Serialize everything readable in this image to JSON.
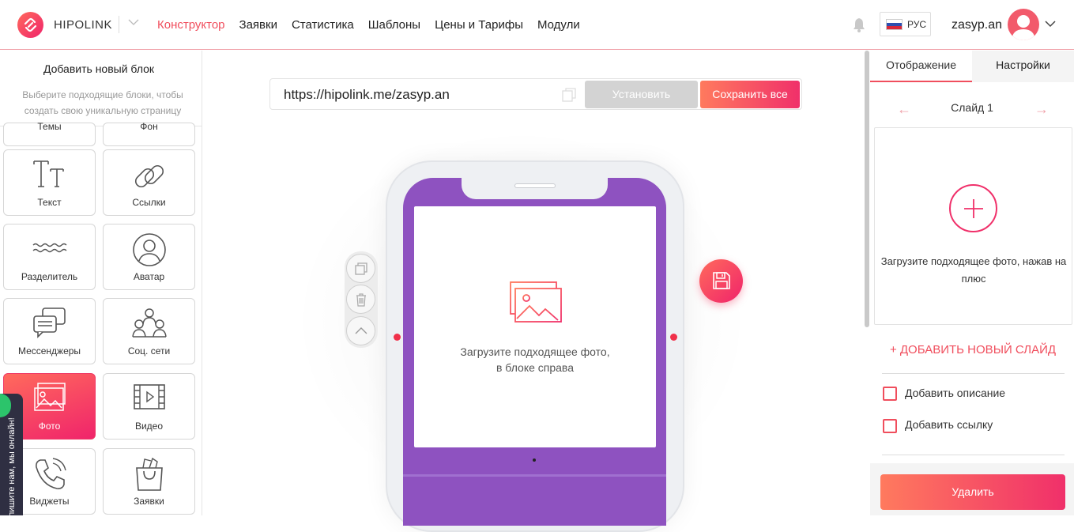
{
  "header": {
    "brand": "HIPOLINK",
    "nav": [
      {
        "label": "Конструктор",
        "active": true
      },
      {
        "label": "Заявки"
      },
      {
        "label": "Статистика"
      },
      {
        "label": "Шаблоны"
      },
      {
        "label": "Цены и Тарифы"
      },
      {
        "label": "Модули"
      }
    ],
    "lang": "РУС",
    "username": "zasyp.an",
    "accent_color": "#f04e5d"
  },
  "left_panel": {
    "title": "Добавить новый блок",
    "subtitle": "Выберите подходящие блоки, чтобы создать свою уникальную страницу",
    "tiles": [
      {
        "label": "Темы"
      },
      {
        "label": "Фон"
      },
      {
        "label": "Текст",
        "icon": "text-icon"
      },
      {
        "label": "Ссылки",
        "icon": "link-icon"
      },
      {
        "label": "Разделитель",
        "icon": "wave-divider-icon"
      },
      {
        "label": "Аватар",
        "icon": "avatar-icon"
      },
      {
        "label": "Мессенджеры",
        "icon": "chat-bubbles-icon"
      },
      {
        "label": "Соц. сети",
        "icon": "people-icon"
      },
      {
        "label": "Фото",
        "icon": "photo-icon",
        "active": true
      },
      {
        "label": "Видео",
        "icon": "video-icon"
      },
      {
        "label": "Виджеты",
        "icon": "phone-icon"
      },
      {
        "label": "Заявки",
        "icon": "bag-icon"
      }
    ],
    "chat_tab": "Напишите нам, мы онлайн!"
  },
  "editor": {
    "url": "https://hipolink.me/zasyp.an",
    "install_label": "Установить",
    "save_all_label": "Сохранить все",
    "photo_placeholder": [
      "Загрузите подходящее фото,",
      "в блоке справа"
    ]
  },
  "right_panel": {
    "tabs": [
      "Отображение",
      "Настройки"
    ],
    "slide_label": "Слайд 1",
    "upload_hint": "Загрузите подходящее фото, нажав на плюс",
    "add_slide_label": "+ ДОБАВИТЬ НОВЫЙ СЛАЙД",
    "checkboxes": [
      "Добавить описание",
      "Добавить ссылку"
    ],
    "delete_label": "Удалить"
  }
}
